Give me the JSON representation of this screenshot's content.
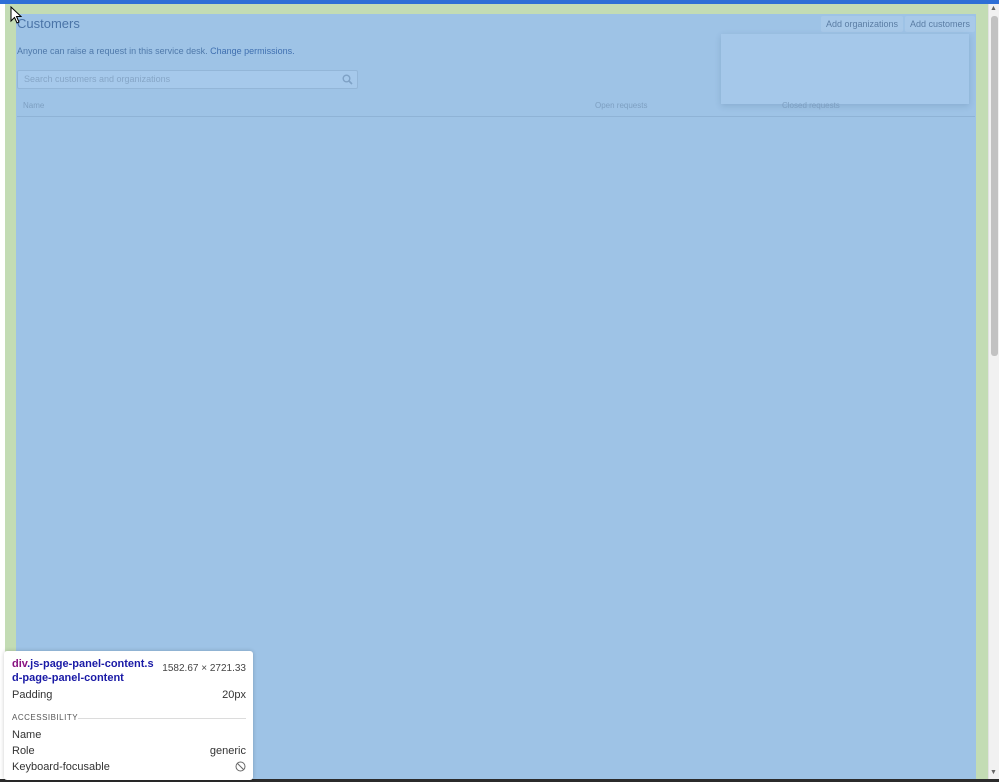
{
  "page": {
    "title": "Customers",
    "buttons": {
      "add_organizations": "Add organizations",
      "add_customers": "Add customers"
    },
    "permissions": {
      "text": "Anyone can raise a request in this service desk.",
      "link": "Change permissions."
    },
    "search": {
      "placeholder": "Search customers and organizations",
      "icon": "search-icon"
    },
    "table": {
      "columns": [
        "Name",
        "Open requests",
        "Closed requests"
      ]
    }
  },
  "devtools_tooltip": {
    "selector_tag": "div",
    "selector_classes": ".js-page-panel-content.sd-page-panel-content",
    "size": "1582.67 × 2721.33",
    "padding_label": "Padding",
    "padding_value": "20px",
    "section": "ACCESSIBILITY",
    "name_label": "Name",
    "role_label": "Role",
    "role_value": "generic",
    "keyboard_label": "Keyboard-focusable",
    "keyboard_icon": "no-entry-icon"
  },
  "colors": {
    "content_highlight": "#9ec3e6",
    "padding_highlight": "#c3dcb4",
    "top_strip": "#2e6fd6"
  }
}
